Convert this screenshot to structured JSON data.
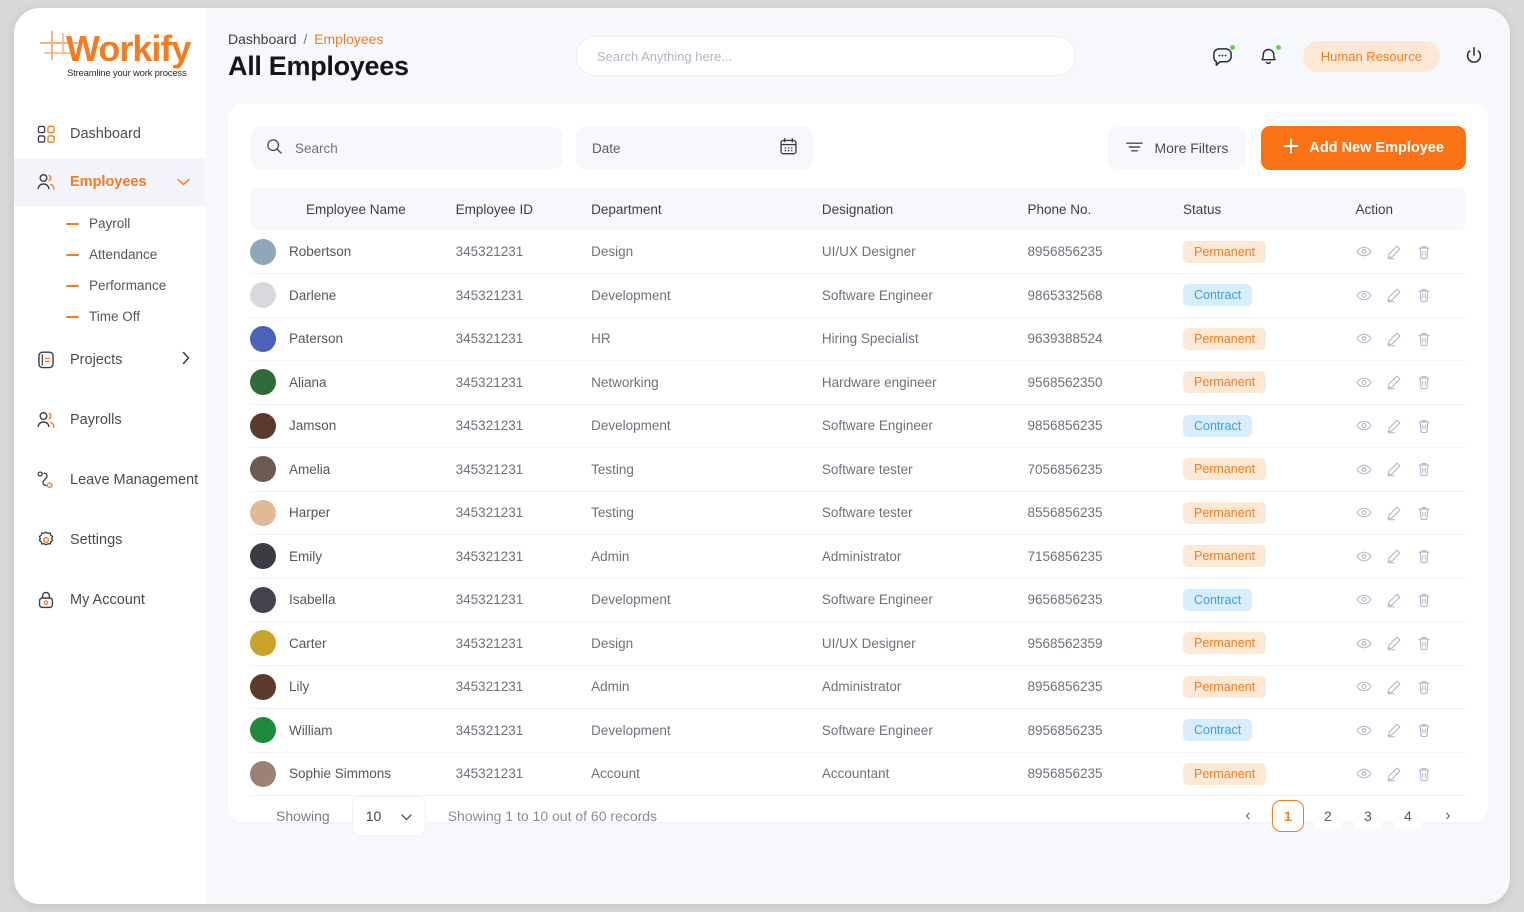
{
  "brand": {
    "name": "Workify",
    "tagline": "Streamline your work process"
  },
  "sidebar": {
    "items": [
      {
        "label": "Dashboard",
        "icon": "grid-icon"
      },
      {
        "label": "Employees",
        "icon": "users-icon",
        "active": true,
        "expanded": true
      },
      {
        "label": "Projects",
        "icon": "projects-icon"
      },
      {
        "label": "Payrolls",
        "icon": "payroll-users-icon"
      },
      {
        "label": "Leave Management",
        "icon": "leave-icon"
      },
      {
        "label": "Settings",
        "icon": "gear-icon"
      },
      {
        "label": "My Account",
        "icon": "lock-icon"
      }
    ],
    "sub_items": [
      {
        "label": "Payroll"
      },
      {
        "label": "Attendance"
      },
      {
        "label": "Performance"
      },
      {
        "label": "Time Off"
      }
    ]
  },
  "header": {
    "breadcrumb_root": "Dashboard",
    "breadcrumb_sep": "/",
    "breadcrumb_current": "Employees",
    "page_title": "All Employees",
    "search_placeholder": "Search Anything here...",
    "search_value": "",
    "role_badge": "Human Resource"
  },
  "filters": {
    "search_placeholder": "Search",
    "search_value": "",
    "date_label": "Date",
    "more_filters_label": "More Filters",
    "add_button_label": "Add New Employee",
    "add_button_plus": "+"
  },
  "table": {
    "columns": [
      "Employee Name",
      "Employee ID",
      "Department",
      "Designation",
      "Phone No.",
      "Status",
      "Action"
    ],
    "rows": [
      {
        "name": "Robertson",
        "id": "345321231",
        "department": "Design",
        "designation": "UI/UX Designer",
        "phone": "8956856235",
        "status": "Permanent",
        "avatar": "#8fa8b8"
      },
      {
        "name": "Darlene",
        "id": "345321231",
        "department": "Development",
        "designation": "Software Engineer",
        "phone": "9865332568",
        "status": "Contract",
        "avatar": "#d9d9dd"
      },
      {
        "name": "Paterson",
        "id": "345321231",
        "department": "HR",
        "designation": "Hiring Specialist",
        "phone": "9639388524",
        "status": "Permanent",
        "avatar": "#4a63b8"
      },
      {
        "name": "Aliana",
        "id": "345321231",
        "department": "Networking",
        "designation": "Hardware engineer",
        "phone": "9568562350",
        "status": "Permanent",
        "avatar": "#2f6b3a"
      },
      {
        "name": "Jamson",
        "id": "345321231",
        "department": "Development",
        "designation": "Software Engineer",
        "phone": "9856856235",
        "status": "Contract",
        "avatar": "#5a3a2a"
      },
      {
        "name": "Amelia",
        "id": "345321231",
        "department": "Testing",
        "designation": "Software tester",
        "phone": "7056856235",
        "status": "Permanent",
        "avatar": "#6f5a52"
      },
      {
        "name": "Harper",
        "id": "345321231",
        "department": "Testing",
        "designation": "Software tester",
        "phone": "8556856235",
        "status": "Permanent",
        "avatar": "#e3b894"
      },
      {
        "name": "Emily",
        "id": "345321231",
        "department": "Admin",
        "designation": "Administrator",
        "phone": "7156856235",
        "status": "Permanent",
        "avatar": "#3b3b43"
      },
      {
        "name": "Isabella",
        "id": "345321231",
        "department": "Development",
        "designation": "Software Engineer",
        "phone": "9656856235",
        "status": "Contract",
        "avatar": "#43434d"
      },
      {
        "name": "Carter",
        "id": "345321231",
        "department": "Design",
        "designation": "UI/UX Designer",
        "phone": "9568562359",
        "status": "Permanent",
        "avatar": "#c9a227"
      },
      {
        "name": "Lily",
        "id": "345321231",
        "department": "Admin",
        "designation": "Administrator",
        "phone": "8956856235",
        "status": "Permanent",
        "avatar": "#5c3a2e"
      },
      {
        "name": "William",
        "id": "345321231",
        "department": "Development",
        "designation": "Software Engineer",
        "phone": "8956856235",
        "status": "Contract",
        "avatar": "#1f8a3b"
      },
      {
        "name": "Sophie Simmons",
        "id": "345321231",
        "department": "Account",
        "designation": "Accountant",
        "phone": "8956856235",
        "status": "Permanent",
        "avatar": "#9c8276"
      }
    ],
    "action_icons": [
      "eye-icon",
      "edit-icon",
      "delete-icon"
    ]
  },
  "footer": {
    "showing_label": "Showing",
    "per_page_value": "10",
    "records_text": "Showing 1 to 10 out of 60 records",
    "pages": [
      "1",
      "2",
      "3",
      "4"
    ],
    "active_page": "1",
    "prev_glyph": "‹",
    "next_glyph": "›"
  },
  "colors": {
    "accent": "#f47b20",
    "accent_button": "#f97316",
    "permanent_bg": "#fde8d5",
    "permanent_fg": "#f47b20",
    "contract_bg": "#d9eefc",
    "contract_fg": "#38a0ef",
    "page_bg": "#f7f8fc",
    "notification_dot": "#5ad545"
  }
}
